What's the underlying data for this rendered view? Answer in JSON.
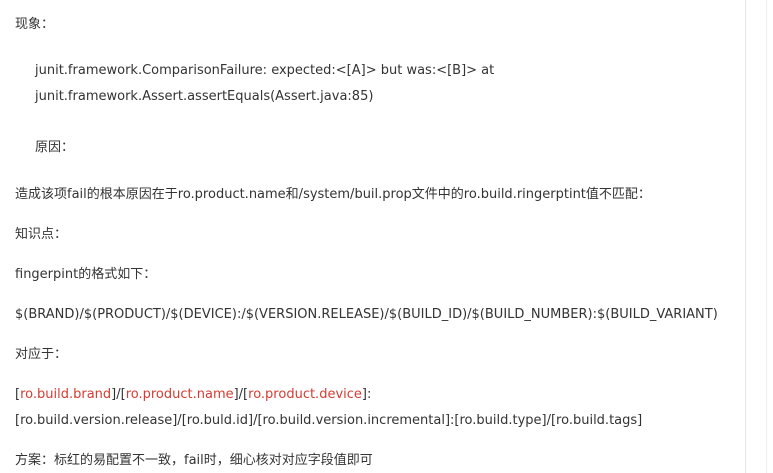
{
  "phenomenon_label": "现象：",
  "error_line1": "junit.framework.ComparisonFailure: expected:<[A]> but was:<[B]> at",
  "error_line2": "junit.framework.Assert.assertEquals(Assert.java:85)",
  "cause_label": "原因：",
  "cause_text": "造成该项fail的根本原因在于ro.product.name和/system/buil.prop文件中的ro.build.ringerptint值不匹配：",
  "knowledge_label": "知识点：",
  "fingerprint_label": "fingerpint的格式如下：",
  "fingerprint_format": "$(BRAND)/$(PRODUCT)/$(DEVICE):/$(VERSION.RELEASE)/$(BUILD_ID)/$(BUILD_NUMBER):$(BUILD_VARIANT)",
  "corresponds_label": "对应于：",
  "mapping_line1": {
    "open1": "[",
    "brand": "ro.build.brand",
    "sep1": "]/[",
    "product": "ro.product.name",
    "sep2": "]/[",
    "device": "ro.product.device",
    "close": "]:"
  },
  "mapping_line2": "[ro.build.version.release]/[ro.buld.id]/[ro.build.version.incremental]:[ro.build.type]/[ro.build.tags]",
  "solution_text": "方案：标红的易配置不一致，fail时，细心核对对应字段值即可",
  "colors": {
    "text": "#333333",
    "highlight": "#d43c33"
  }
}
